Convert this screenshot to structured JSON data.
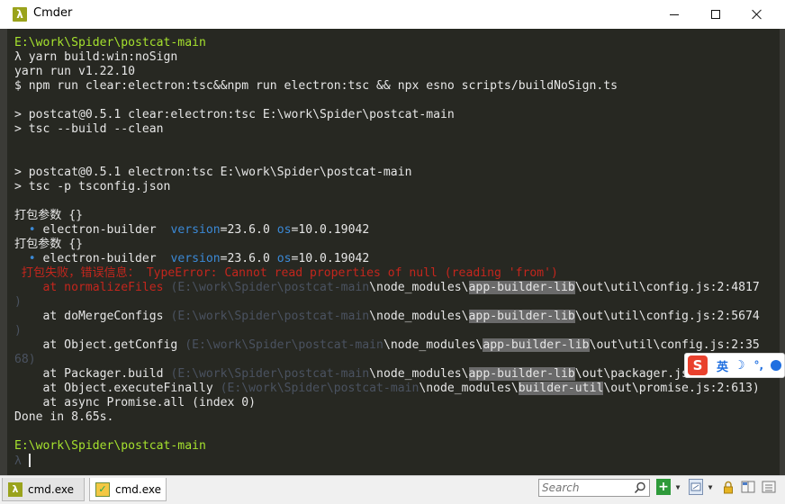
{
  "window": {
    "title": "Cmder",
    "app_icon_glyph": "λ"
  },
  "console": {
    "lines": [
      [
        {
          "t": "E:\\work\\Spider\\postcat-main",
          "c": "path-green"
        }
      ],
      [
        {
          "t": "λ yarn build:win:noSign"
        }
      ],
      [
        {
          "t": "yarn run v1.22.10"
        }
      ],
      [
        {
          "t": "$ npm run clear:electron:tsc&&npm run electron:tsc && npx esno scripts/buildNoSign.ts"
        }
      ],
      [],
      [
        {
          "t": "> postcat@0.5.1 clear:electron:tsc E:\\work\\Spider\\postcat-main"
        }
      ],
      [
        {
          "t": "> tsc --build --clean"
        }
      ],
      [],
      [],
      [
        {
          "t": "> postcat@0.5.1 electron:tsc E:\\work\\Spider\\postcat-main"
        }
      ],
      [
        {
          "t": "> tsc -p tsconfig.json"
        }
      ],
      [],
      [
        {
          "t": "打包参数 {}"
        }
      ],
      [
        {
          "t": "  "
        },
        {
          "t": "•",
          "c": "blue"
        },
        {
          "t": " electron-builder  "
        },
        {
          "t": "version",
          "c": "blue"
        },
        {
          "t": "=23.6.0 "
        },
        {
          "t": "os",
          "c": "blue"
        },
        {
          "t": "=10.0.19042"
        }
      ],
      [
        {
          "t": "打包参数 {}"
        }
      ],
      [
        {
          "t": "  "
        },
        {
          "t": "•",
          "c": "blue"
        },
        {
          "t": " electron-builder  "
        },
        {
          "t": "version",
          "c": "blue"
        },
        {
          "t": "=23.6.0 "
        },
        {
          "t": "os",
          "c": "blue"
        },
        {
          "t": "=10.0.19042"
        }
      ],
      [
        {
          "t": " 打包失败，错误信息： TypeError: Cannot read properties of null (reading 'from')",
          "c": "red"
        }
      ],
      [
        {
          "t": "    at normalizeFiles ",
          "c": "red"
        },
        {
          "t": "(E:\\work\\Spider\\postcat-main",
          "c": "muted"
        },
        {
          "t": "\\node_modules\\"
        },
        {
          "t": "app-builder-lib",
          "c": "hl"
        },
        {
          "t": "\\out\\util\\config.js:2:4817"
        }
      ],
      [
        {
          "t": ")",
          "c": "muted"
        }
      ],
      [
        {
          "t": "    at doMergeConfigs "
        },
        {
          "t": "(E:\\work\\Spider\\postcat-main",
          "c": "muted"
        },
        {
          "t": "\\node_modules\\"
        },
        {
          "t": "app-builder-lib",
          "c": "hl"
        },
        {
          "t": "\\out\\util\\config.js:2:5674"
        }
      ],
      [
        {
          "t": ")",
          "c": "muted"
        }
      ],
      [
        {
          "t": "    at Object.getConfig "
        },
        {
          "t": "(E:\\work\\Spider\\postcat-main",
          "c": "muted"
        },
        {
          "t": "\\node_modules\\"
        },
        {
          "t": "app-builder-lib",
          "c": "hl"
        },
        {
          "t": "\\out\\util\\config.js:2:35"
        }
      ],
      [
        {
          "t": "68)",
          "c": "muted"
        }
      ],
      [
        {
          "t": "    at Packager.build "
        },
        {
          "t": "(E:\\work\\Spider\\postcat-main",
          "c": "muted"
        },
        {
          "t": "\\node_modules\\"
        },
        {
          "t": "app-builder-lib",
          "c": "hl"
        },
        {
          "t": "\\out\\packager.js:2:"
        }
      ],
      [
        {
          "t": "    at Object.executeFinally "
        },
        {
          "t": "(E:\\work\\Spider\\postcat-main",
          "c": "muted"
        },
        {
          "t": "\\node_modules\\"
        },
        {
          "t": "builder-util",
          "c": "hl"
        },
        {
          "t": "\\out\\promise.js:2:613)"
        }
      ],
      [
        {
          "t": "    at async Promise.all (index 0)"
        }
      ],
      [
        {
          "t": "Done in 8.65s."
        }
      ],
      [],
      [
        {
          "t": "E:\\work\\Spider\\postcat-main",
          "c": "path-green"
        }
      ],
      [
        {
          "t": "λ",
          "c": "muted"
        }
      ]
    ]
  },
  "ime": {
    "logo": "S",
    "lang": "英",
    "moon": "☽",
    "punctuation": "°,",
    "colors": {
      "accent": "#1f6fe0",
      "logo": "#e9412d"
    }
  },
  "statusbar": {
    "tabs": [
      {
        "label": "cmd.exe",
        "icon": "lambda-icon"
      },
      {
        "label": "cmd.exe",
        "icon": "cmd-icon"
      }
    ],
    "search": {
      "placeholder": "Search"
    },
    "add_label": "+"
  },
  "colors": {
    "background": "#272822",
    "path": "#a6e22e",
    "error": "#c4261d",
    "info": "#3b89d6",
    "highlight": "#6a6a6a"
  }
}
